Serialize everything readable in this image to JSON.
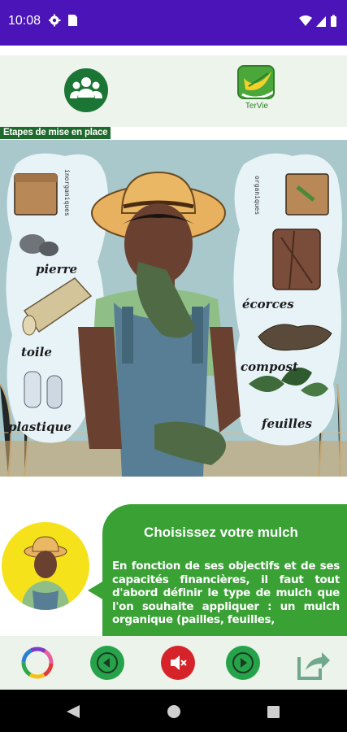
{
  "status_bar": {
    "time": "10:08",
    "left_icons": [
      "gear-icon",
      "sim-card-icon"
    ],
    "right_icons": [
      "wifi-icon",
      "cellular-signal-icon",
      "battery-icon"
    ],
    "background": "#4b14b8"
  },
  "header": {
    "group_icon": "group-icon",
    "logo_text": "TerVie"
  },
  "section": {
    "label": "Etapes de mise en place"
  },
  "illustration": {
    "left_cloud_title": "inorganiques",
    "right_cloud_title": "organiques",
    "left_items": [
      "pierre",
      "toile",
      "plastique"
    ],
    "right_items": [
      "écorces",
      "compost",
      "feuilles"
    ]
  },
  "dialog": {
    "title": "Choisissez votre mulch",
    "text": "En fonction de ses objectifs et de ses capacités financières, il faut tout d'abord définir le type de mulch que l'on souhaite appliquer : un mulch organique (pailles, feuilles,",
    "bubble_color": "#3aa135",
    "avatar_background": "#f6e21a"
  },
  "toolbar": {
    "icons": [
      "color-wheel-icon",
      "previous-icon",
      "mute-icon",
      "next-icon",
      "share-icon"
    ],
    "accent": "#26a34a",
    "mute_color": "#d6232a"
  },
  "nav_bar": {
    "icons": [
      "back-triangle-icon",
      "home-circle-icon",
      "recents-square-icon"
    ]
  }
}
